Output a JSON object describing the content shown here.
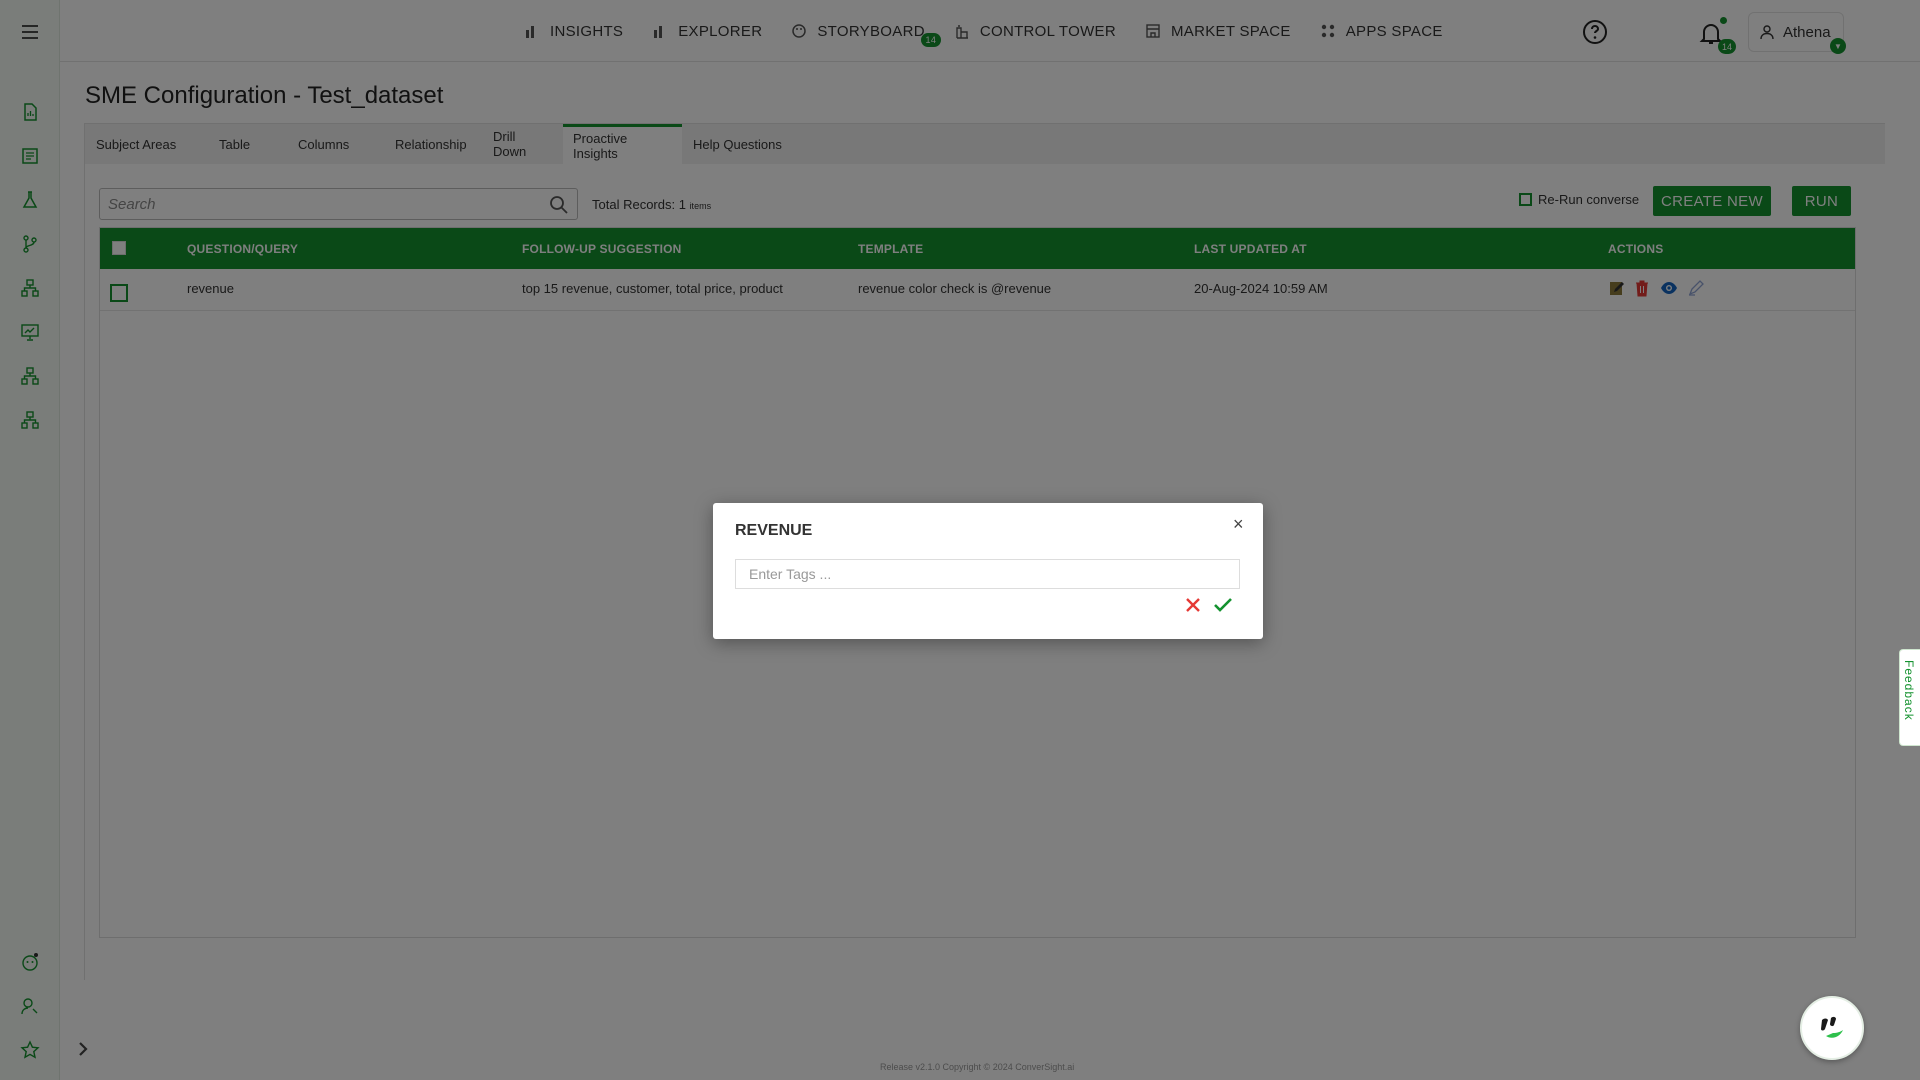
{
  "nav": {
    "items": [
      {
        "label": "INSIGHTS",
        "icon": "bar-chart-icon"
      },
      {
        "label": "EXPLORER",
        "icon": "bar-chart-icon"
      },
      {
        "label": "STORYBOARD",
        "icon": "palette-icon",
        "badge": "14"
      },
      {
        "label": "CONTROL TOWER",
        "icon": "tower-icon"
      },
      {
        "label": "MARKET SPACE",
        "icon": "store-icon"
      },
      {
        "label": "APPS SPACE",
        "icon": "apps-grid-icon"
      }
    ],
    "notification_count": "14",
    "user_name": "Athena"
  },
  "page": {
    "title": "SME Configuration - Test_dataset",
    "tabs": [
      "Subject Areas",
      "Table",
      "Columns",
      "Relationship",
      "Drill Down",
      "Proactive Insights",
      "Help Questions"
    ],
    "active_tab": "Proactive Insights"
  },
  "toolbar": {
    "search_placeholder": "Search",
    "total_label": "Total Records: 1",
    "total_suffix": "items",
    "rerun_label": "Re-Run converse",
    "create_label": "CREATE NEW",
    "run_label": "RUN"
  },
  "table": {
    "columns": [
      "QUESTION/QUERY",
      "FOLLOW-UP SUGGESTION",
      "TEMPLATE",
      "LAST UPDATED AT",
      "ACTIONS"
    ],
    "rows": [
      {
        "question": "revenue",
        "followup": "top 15 revenue, customer, total price, product",
        "template": "revenue color check is @revenue",
        "updated": "20-Aug-2024 10:59 AM"
      }
    ]
  },
  "modal": {
    "title": "REVENUE",
    "close_glyph": "×",
    "tags_placeholder": "Enter Tags ..."
  },
  "footer": "Release v2.1.0 Copyright © 2024 ConverSight.ai",
  "feedback_label": "Feedback",
  "colors": {
    "accent": "#14922f",
    "danger": "#e53935",
    "eye": "#1565c0"
  }
}
